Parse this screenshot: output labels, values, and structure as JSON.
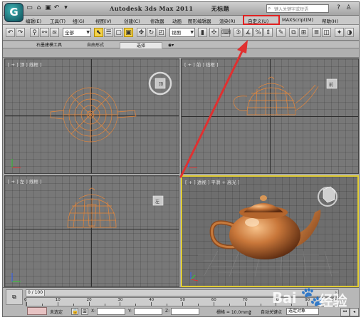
{
  "title_bar": {
    "app_name": "Autodesk 3ds Max  2011",
    "doc_name": "无标题",
    "search_placeholder": "键入关键字或短语",
    "logo_letter": "G"
  },
  "menu": {
    "items": [
      "编辑(E)",
      "工具(T)",
      "组(G)",
      "视图(V)",
      "创建(C)",
      "修改器",
      "动画",
      "图形编辑器",
      "渲染(R)",
      "自定义(U)",
      "MAXScript(M)",
      "帮助(H)"
    ],
    "highlight_index": 9,
    "highlight_color": "#e02020"
  },
  "toolbar": {
    "filter_value": "全部",
    "refcoord_value": "视图"
  },
  "ribbon": {
    "tabs": [
      "石墨建模工具",
      "自由形式",
      "选择"
    ],
    "active_index": 2
  },
  "viewports": {
    "top_label": "[ + ] 顶 ] 线框 ]",
    "front_label": "[ + ] 前 ] 线框 ]",
    "left_label": "[ + ] 左 ] 线框 ]",
    "persp_label": "[ + ] 透视 ] 平滑 + 高光 ]",
    "wire_color": "#e8873a",
    "active_border_color": "#e0cc33"
  },
  "status": {
    "time_value": "0 / 100",
    "track_labels": [
      "0",
      "10",
      "20",
      "30",
      "40",
      "50",
      "60",
      "70",
      "80",
      "90",
      "100"
    ],
    "selection_text": "未选定",
    "x_label": "X:",
    "y_label": "Y:",
    "z_label": "Z:",
    "grid_text": "栅格 = 10.0mm",
    "autokey_label": "自动关键点",
    "set_label": "选定对象"
  },
  "watermark": {
    "brand": "Bai",
    "suffix": "经验"
  },
  "annotation": {
    "arrow_color": "#e03030"
  }
}
